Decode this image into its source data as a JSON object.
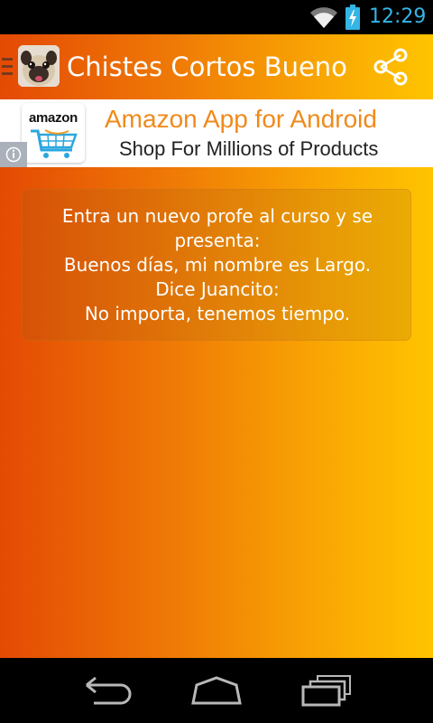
{
  "status_bar": {
    "time": "12:29",
    "time_color": "#33b5e5",
    "icons": [
      "wifi-icon",
      "battery-charging-icon"
    ]
  },
  "app": {
    "title": "Chistes Cortos Bueno",
    "icon": "pug-dog-app-icon",
    "share_icon": "share-icon",
    "background_gradient": [
      "#e44a04",
      "#ffc400"
    ]
  },
  "ad": {
    "logo_text": "amazon",
    "title": "Amazon App for Android",
    "subtitle": "Shop For Millions of Products",
    "title_color": "#f08a1b",
    "info_icon": "info-icon"
  },
  "joke": {
    "lines": [
      "Entra un nuevo profe al curso y se",
      "presenta:",
      "Buenos días, mi nombre es Largo.",
      "Dice Juancito:",
      "No importa, tenemos tiempo."
    ]
  },
  "navigation_bar": {
    "buttons": [
      "back-icon",
      "home-icon",
      "recent-apps-icon"
    ]
  }
}
